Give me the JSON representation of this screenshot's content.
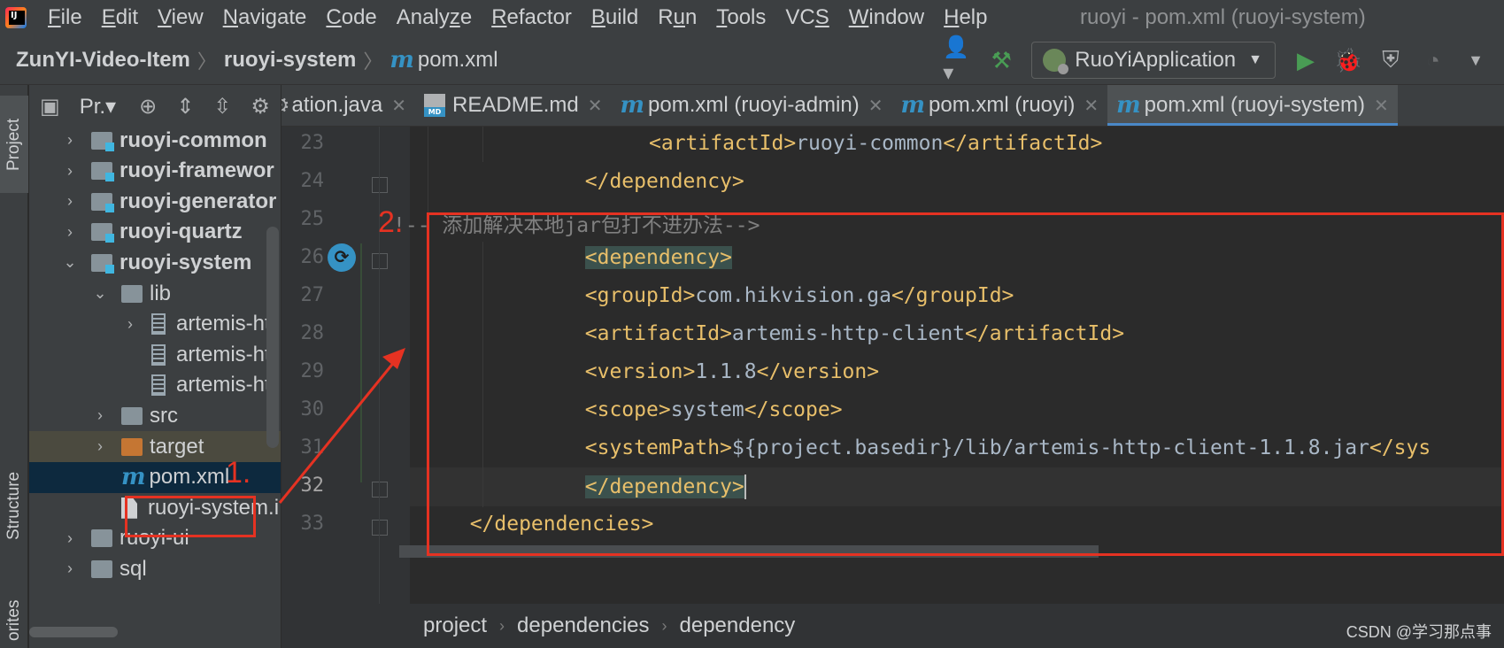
{
  "menubar": {
    "items": [
      {
        "label": "File",
        "mn": "F",
        "rest": "ile"
      },
      {
        "label": "Edit",
        "mn": "E",
        "rest": "dit"
      },
      {
        "label": "View",
        "mn": "V",
        "rest": "iew"
      },
      {
        "label": "Navigate",
        "mn": "N",
        "rest": "avigate"
      },
      {
        "label": "Code",
        "mn": "C",
        "rest": "ode"
      },
      {
        "label": "Analyze",
        "pre": "Analy",
        "mn": "z",
        "rest": "e"
      },
      {
        "label": "Refactor",
        "mn": "R",
        "rest": "efactor"
      },
      {
        "label": "Build",
        "mn": "B",
        "rest": "uild"
      },
      {
        "label": "Run",
        "pre": "R",
        "mn": "u",
        "rest": "n"
      },
      {
        "label": "Tools",
        "mn": "T",
        "rest": "ools"
      },
      {
        "label": "VCS",
        "pre": "VC",
        "mn": "S",
        "rest": ""
      },
      {
        "label": "Window",
        "mn": "W",
        "rest": "indow"
      },
      {
        "label": "Help",
        "mn": "H",
        "rest": "elp"
      }
    ],
    "window_title": "ruoyi - pom.xml (ruoyi-system)"
  },
  "navbar": {
    "crumbs": [
      "ZunYI-Video-Item",
      "ruoyi-system",
      "pom.xml"
    ],
    "run_config": "RuoYiApplication"
  },
  "side_tabs": {
    "project": "Project",
    "structure": "Structure",
    "favorites": "orites"
  },
  "project_panel": {
    "title": "Pr.",
    "tree": [
      {
        "label": "ruoyi-common",
        "bold": true,
        "arrow": "›",
        "kind": "module",
        "indent": 0
      },
      {
        "label": "ruoyi-framewor",
        "bold": true,
        "arrow": "›",
        "kind": "module",
        "indent": 0
      },
      {
        "label": "ruoyi-generator",
        "bold": true,
        "arrow": "›",
        "kind": "module",
        "indent": 0
      },
      {
        "label": "ruoyi-quartz",
        "bold": true,
        "arrow": "›",
        "kind": "module",
        "indent": 0
      },
      {
        "label": "ruoyi-system",
        "bold": true,
        "arrow": "⌄",
        "kind": "module",
        "indent": 0
      },
      {
        "label": "lib",
        "bold": false,
        "arrow": "⌄",
        "kind": "folder",
        "indent": 1
      },
      {
        "label": "artemis-htt",
        "bold": false,
        "arrow": "›",
        "kind": "jar",
        "indent": 2
      },
      {
        "label": "artemis-htt",
        "bold": false,
        "arrow": "",
        "kind": "jar",
        "indent": 2
      },
      {
        "label": "artemis-htt",
        "bold": false,
        "arrow": "",
        "kind": "jar",
        "indent": 2
      },
      {
        "label": "src",
        "bold": false,
        "arrow": "›",
        "kind": "folder",
        "indent": 1
      },
      {
        "label": "target",
        "bold": false,
        "arrow": "›",
        "kind": "orange",
        "indent": 1
      },
      {
        "label": "pom.xml",
        "bold": false,
        "arrow": "",
        "kind": "maven",
        "indent": 1,
        "selected": true
      },
      {
        "label": "ruoyi-system.i",
        "bold": false,
        "arrow": "",
        "kind": "file",
        "indent": 1
      },
      {
        "label": "ruoyi-ui",
        "bold": false,
        "arrow": "›",
        "kind": "folder",
        "indent": 0
      },
      {
        "label": "sql",
        "bold": false,
        "arrow": "›",
        "kind": "folder",
        "indent": 0
      }
    ]
  },
  "editor_tabs": [
    {
      "label": "ation.java",
      "icon": "",
      "active": false
    },
    {
      "label": "README.md",
      "icon": "md",
      "active": false
    },
    {
      "label": "pom.xml (ruoyi-admin)",
      "icon": "m",
      "active": false
    },
    {
      "label": "pom.xml (ruoyi)",
      "icon": "m",
      "active": false
    },
    {
      "label": "pom.xml (ruoyi-system)",
      "icon": "m",
      "active": true
    }
  ],
  "editor": {
    "line_numbers": [
      "23",
      "24",
      "25",
      "26",
      "27",
      "28",
      "29",
      "30",
      "31",
      "32",
      "33"
    ],
    "current_line": "32",
    "lines": [
      {
        "indent": 20,
        "parts": [
          [
            "tag",
            "<artifactId>"
          ],
          [
            "txt",
            "ruoyi-common"
          ],
          [
            "tag",
            "</artifactId>"
          ]
        ]
      },
      {
        "indent": 15,
        "parts": [
          [
            "tag",
            "</dependency>"
          ]
        ]
      },
      {
        "indent": 0,
        "parts": [
          [
            "cmt",
            "!-- 添加解决本地jar包打不进办法-->"
          ]
        ]
      },
      {
        "indent": 15,
        "parts": [
          [
            "tag",
            "<dependency>"
          ]
        ]
      },
      {
        "indent": 15,
        "parts": [
          [
            "tag",
            "<groupId>"
          ],
          [
            "txt",
            "com.hikvision.ga"
          ],
          [
            "tag",
            "</groupId>"
          ]
        ]
      },
      {
        "indent": 15,
        "parts": [
          [
            "tag",
            "<artifactId>"
          ],
          [
            "txt",
            "artemis-http-client"
          ],
          [
            "tag",
            "</artifactId>"
          ]
        ]
      },
      {
        "indent": 15,
        "parts": [
          [
            "tag",
            "<version>"
          ],
          [
            "txt",
            "1.1.8"
          ],
          [
            "tag",
            "</version>"
          ]
        ]
      },
      {
        "indent": 15,
        "parts": [
          [
            "tag",
            "<scope>"
          ],
          [
            "txt",
            "system"
          ],
          [
            "tag",
            "</scope>"
          ]
        ]
      },
      {
        "indent": 15,
        "parts": [
          [
            "tag",
            "<systemPath>"
          ],
          [
            "txt",
            "${project.basedir}/lib/artemis-http-client-1.1.8.jar"
          ],
          [
            "tag",
            "</sys"
          ]
        ]
      },
      {
        "indent": 15,
        "parts": [
          [
            "tag",
            "</dependency>"
          ]
        ]
      },
      {
        "indent": 6,
        "parts": [
          [
            "tag",
            "</dependencies>"
          ]
        ]
      }
    ]
  },
  "editor_breadcrumb": [
    "project",
    "dependencies",
    "dependency"
  ],
  "annotations": {
    "step1": "1.",
    "step2": "2."
  },
  "watermark": "CSDN @学习那点事",
  "colors": {
    "accent": "#4a88c7",
    "annotation": "#e53222",
    "xml_tag": "#e8bf6a",
    "comment": "#808080"
  }
}
